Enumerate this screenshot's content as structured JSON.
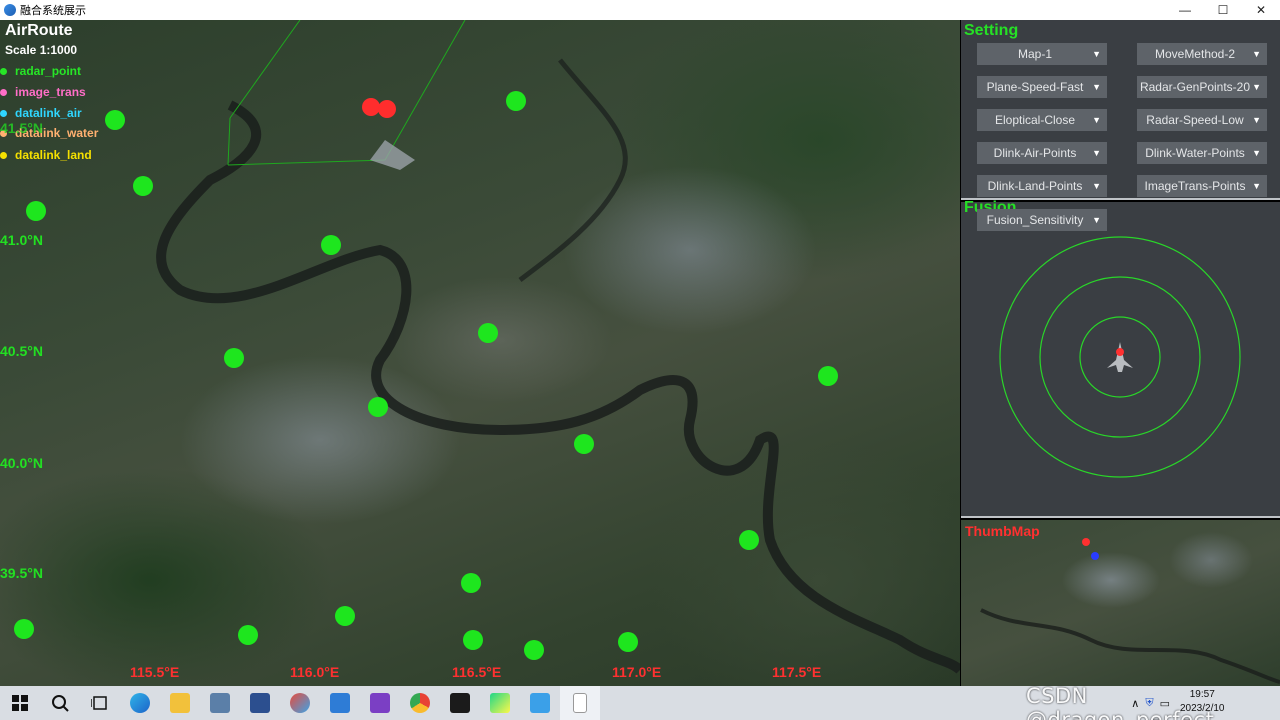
{
  "window": {
    "title": "融合系统展示",
    "buttons": {
      "minimize": "—",
      "maximize": "☐",
      "close": "✕"
    }
  },
  "map": {
    "title": "AirRoute",
    "scale": "Scale 1:1000",
    "legend": [
      {
        "label": "radar_point",
        "color": "#27e627"
      },
      {
        "label": "image_trans",
        "color": "#ff6ec7"
      },
      {
        "label": "datalink_air",
        "color": "#2fd6ff"
      },
      {
        "label": "datalink_water",
        "color": "#ffb070"
      },
      {
        "label": "datalink_land",
        "color": "#f5e000"
      }
    ],
    "partial_lat_label": "41.5°N",
    "lat_labels": [
      "41.0°N",
      "40.5°N",
      "40.0°N",
      "39.5°N"
    ],
    "lon_labels": [
      "115.5°E",
      "116.0°E",
      "116.5°E",
      "117.0°E",
      "117.5°E"
    ],
    "radar_color": "#1ee61e",
    "target_color": "#ff2d2d"
  },
  "setting": {
    "title": "Setting",
    "dropdowns": [
      "Map-1",
      "MoveMethod-2",
      "Plane-Speed-Fast",
      "Radar-GenPoints-20",
      "Eloptical-Close",
      "Radar-Speed-Low",
      "Dlink-Air-Points",
      "Dlink-Water-Points",
      "Dlink-Land-Points",
      "ImageTrans-Points"
    ]
  },
  "fusion": {
    "title": "Fusion",
    "sensitivity": "Fusion_Sensitivity"
  },
  "thumb": {
    "title": "ThumbMap"
  },
  "taskbar": {
    "apps": [
      "windows-start",
      "search",
      "task-view",
      "edge",
      "file-explorer",
      "calculator",
      "app-blue",
      "photos",
      "app-arrow",
      "visual-studio",
      "chrome",
      "terminal",
      "pycharm",
      "app-link",
      "document"
    ],
    "clock_time": "19:57",
    "clock_date": "2023/2/10",
    "watermark": "CSDN @dragon_perfect"
  }
}
